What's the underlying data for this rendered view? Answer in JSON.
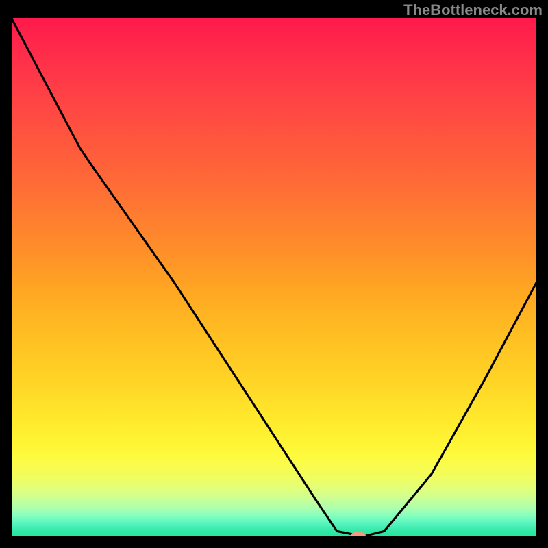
{
  "watermark": "TheBottleneck.com",
  "chart_data": {
    "type": "line",
    "title": "",
    "xlabel": "",
    "ylabel": "",
    "xlim": [
      0,
      100
    ],
    "ylim": [
      0,
      100
    ],
    "x": [
      0,
      13,
      15,
      31,
      58,
      62,
      67,
      71,
      80,
      90,
      100
    ],
    "values": [
      100,
      75,
      72,
      49,
      7,
      1,
      0,
      1,
      12,
      30,
      49
    ],
    "marker": {
      "x": 66,
      "y": 0
    },
    "annotations": [],
    "legend": []
  },
  "colors": {
    "curve": "#000000",
    "marker": "#f19b84",
    "background_frame": "#000000"
  }
}
